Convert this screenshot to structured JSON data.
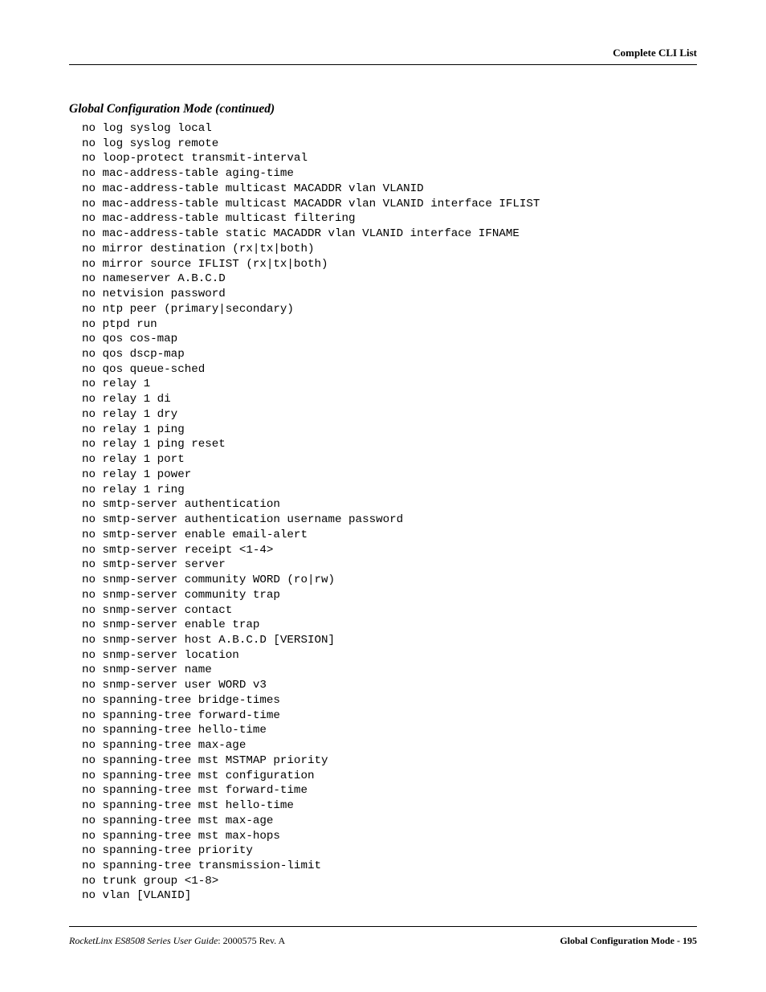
{
  "header": {
    "right": "Complete CLI List"
  },
  "section": {
    "title": "Global Configuration Mode (continued)"
  },
  "cli": {
    "lines": [
      "no log syslog local",
      "no log syslog remote",
      "no loop-protect transmit-interval",
      "no mac-address-table aging-time",
      "no mac-address-table multicast MACADDR vlan VLANID",
      "no mac-address-table multicast MACADDR vlan VLANID interface IFLIST",
      "no mac-address-table multicast filtering",
      "no mac-address-table static MACADDR vlan VLANID interface IFNAME",
      "no mirror destination (rx|tx|both)",
      "no mirror source IFLIST (rx|tx|both)",
      "no nameserver A.B.C.D",
      "no netvision password",
      "no ntp peer (primary|secondary)",
      "no ptpd run",
      "no qos cos-map",
      "no qos dscp-map",
      "no qos queue-sched",
      "no relay 1",
      "no relay 1 di",
      "no relay 1 dry",
      "no relay 1 ping",
      "no relay 1 ping reset",
      "no relay 1 port",
      "no relay 1 power",
      "no relay 1 ring",
      "no smtp-server authentication",
      "no smtp-server authentication username password",
      "no smtp-server enable email-alert",
      "no smtp-server receipt <1-4>",
      "no smtp-server server",
      "no snmp-server community WORD (ro|rw)",
      "no snmp-server community trap",
      "no snmp-server contact",
      "no snmp-server enable trap",
      "no snmp-server host A.B.C.D [VERSION]",
      "no snmp-server location",
      "no snmp-server name",
      "no snmp-server user WORD v3",
      "no spanning-tree bridge-times",
      "no spanning-tree forward-time",
      "no spanning-tree hello-time",
      "no spanning-tree max-age",
      "no spanning-tree mst MSTMAP priority",
      "no spanning-tree mst configuration",
      "no spanning-tree mst forward-time",
      "no spanning-tree mst hello-time",
      "no spanning-tree mst max-age",
      "no spanning-tree mst max-hops",
      "no spanning-tree priority",
      "no spanning-tree transmission-limit",
      "no trunk group <1-8>",
      "no vlan [VLANID]"
    ]
  },
  "footer": {
    "left_italic": "RocketLinx ES8508 Series  User Guide",
    "left_plain": ": 2000575 Rev. A",
    "right": "Global Configuration Mode - 195"
  }
}
